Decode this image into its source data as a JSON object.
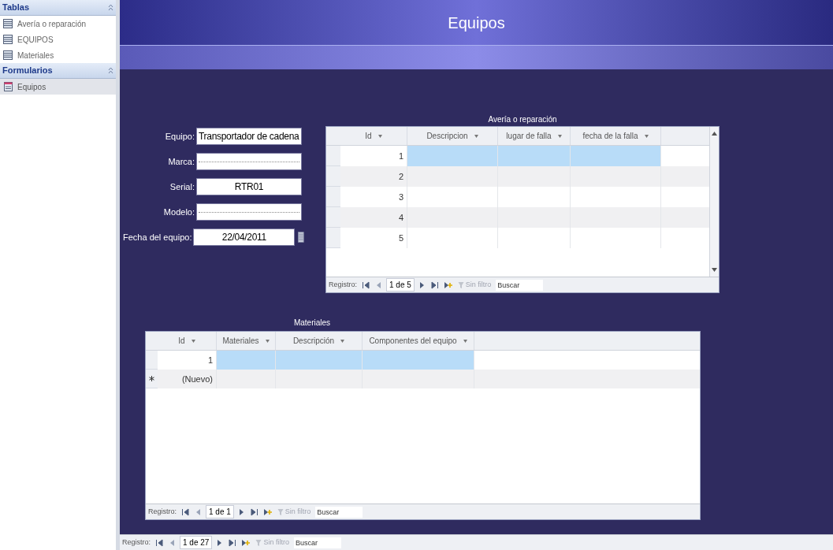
{
  "sidebar": {
    "groups": [
      {
        "title": "Tablas",
        "kind": "table",
        "items": [
          {
            "label": "Avería o reparación",
            "selected": false
          },
          {
            "label": "EQUIPOS",
            "selected": false
          },
          {
            "label": "Materiales",
            "selected": false
          }
        ]
      },
      {
        "title": "Formularios",
        "kind": "form",
        "items": [
          {
            "label": "Equipos",
            "selected": true
          }
        ]
      }
    ]
  },
  "form": {
    "title": "Equipos",
    "fields": [
      {
        "label": "Equipo:",
        "value": "Transportador de cadena",
        "kind": "text",
        "centered": false
      },
      {
        "label": "Marca:",
        "kind": "text"
      },
      {
        "label": "Serial:",
        "value": "RTR01",
        "kind": "text",
        "centered": true
      },
      {
        "label": "Modelo:",
        "kind": "text"
      },
      {
        "label": "Fecha del equipo:",
        "value": "22/04/2011",
        "kind": "date",
        "centered": true
      }
    ],
    "subforms": [
      {
        "title": "Avería o reparación",
        "columns": [
          "Id",
          "Descripcion",
          "lugar de falla",
          "fecha de la falla"
        ],
        "rows": [
          {
            "id": "1",
            "kind": "record",
            "selected": true
          },
          {
            "id": "2",
            "kind": "record",
            "selected": false
          },
          {
            "id": "3",
            "kind": "record",
            "selected": false
          },
          {
            "id": "4",
            "kind": "record",
            "selected": false
          },
          {
            "id": "5",
            "kind": "record",
            "selected": false
          }
        ],
        "navigator": {
          "label": "Registro:",
          "position": "1 de 5",
          "filter": "Sin filtro",
          "placeholder": "Buscar"
        }
      },
      {
        "title": "Materiales",
        "columns": [
          "Id",
          "Materiales",
          "Descripción",
          "Componentes del equipo"
        ],
        "rows": [
          {
            "id": "1",
            "kind": "record",
            "selected": true
          },
          {
            "id": "(Nuevo)",
            "kind": "new",
            "selected": false
          }
        ],
        "navigator": {
          "label": "Registro:",
          "position": "1 de 1",
          "filter": "Sin filtro",
          "placeholder": "Buscar"
        }
      }
    ]
  },
  "navigator": {
    "label": "Registro:",
    "position": "1 de 27",
    "filter": "Sin filtro",
    "placeholder": "Buscar"
  }
}
